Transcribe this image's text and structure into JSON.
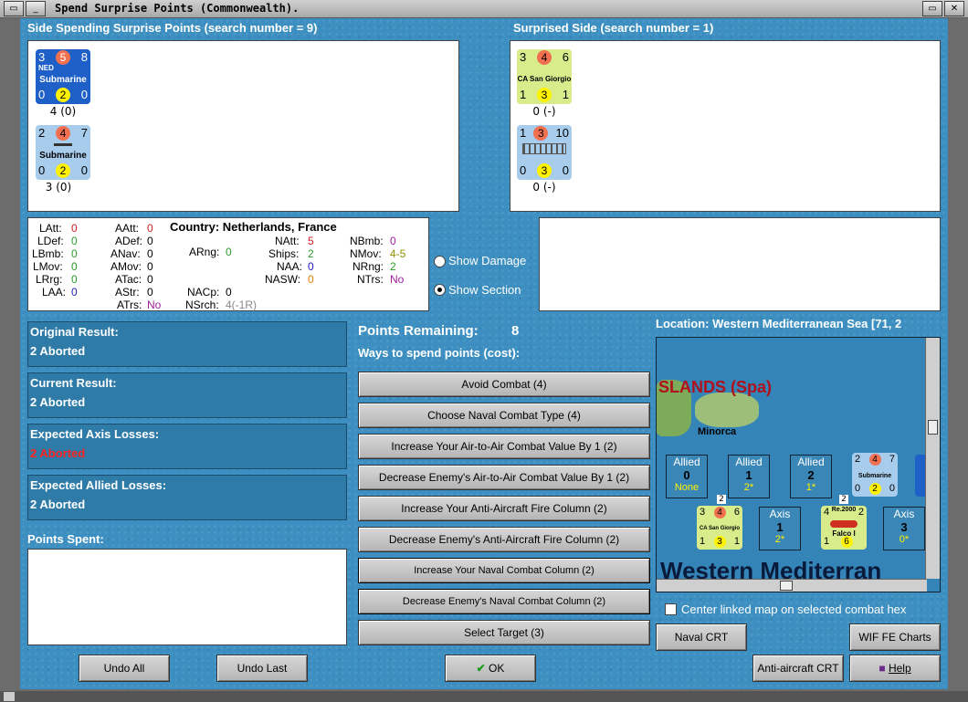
{
  "window": {
    "title": "Spend Surprise Points (Commonwealth)."
  },
  "spending_side": {
    "header": "Side Spending Surprise Points (search number = 9)",
    "units": [
      {
        "top_left": "3",
        "top_mid": "5",
        "top_right": "8",
        "nation": "NED",
        "type": "Submarine",
        "bot_left": "0",
        "bot_mid": "2",
        "bot_right": "0",
        "caption": "4 (0)",
        "color": "#1e5fc8"
      },
      {
        "top_left": "2",
        "top_mid": "4",
        "top_right": "7",
        "nation": "",
        "type": "Submarine",
        "bot_left": "0",
        "bot_mid": "2",
        "bot_right": "0",
        "caption": "3 (0)",
        "color": "#a8ccec"
      }
    ]
  },
  "surprised_side": {
    "header": "Surprised Side (search number = 1)",
    "units": [
      {
        "top_left": "3",
        "top_mid": "4",
        "top_right": "6",
        "type": "CA San Giorgio",
        "bot_left": "1",
        "bot_mid": "3",
        "bot_right": "1",
        "caption": "0 (-)",
        "color": "#d8ec8c"
      },
      {
        "top_left": "1",
        "top_mid": "3",
        "top_right": "10",
        "type": "",
        "bot_left": "0",
        "bot_mid": "3",
        "bot_right": "0",
        "caption": "0 (-)",
        "color": "#a8ccec"
      }
    ]
  },
  "stats": {
    "latt_label": "LAtt:",
    "latt": "0",
    "ldef_label": "LDef:",
    "ldef": "0",
    "lbmb_label": "LBmb:",
    "lbmb": "0",
    "lmov_label": "LMov:",
    "lmov": "0",
    "lrrg_label": "LRrg:",
    "lrrg": "0",
    "laa_label": "LAA:",
    "laa": "0",
    "aatt_label": "AAtt:",
    "aatt": "0",
    "adef_label": "ADef:",
    "adef": "0",
    "anav_label": "ANav:",
    "anav": "0",
    "amov_label": "AMov:",
    "amov": "0",
    "atac_label": "ATac:",
    "atac": "0",
    "astr_label": "AStr:",
    "astr": "0",
    "atrs_label": "ATrs:",
    "atrs": "No",
    "country": "Country: Netherlands, France",
    "arng_label": "ARng:",
    "arng": "0",
    "nacp_label": "NACp:",
    "nacp": "0",
    "nsrch_label": "NSrch:",
    "nsrch": "4(-1R)",
    "natt_label": "NAtt:",
    "natt": "5",
    "ships_label": "Ships:",
    "ships": "2",
    "naa_label": "NAA:",
    "naa": "0",
    "nasw_label": "NASW:",
    "nasw": "0",
    "nbmb_label": "NBmb:",
    "nbmb": "0",
    "nmov_label": "NMov:",
    "nmov": "4-5",
    "nrng_label": "NRng:",
    "nrng": "2",
    "ntrs_label": "NTrs:",
    "ntrs": "No"
  },
  "options": {
    "show_damage": "Show Damage",
    "show_section": "Show Section"
  },
  "results": [
    {
      "title": "Original Result:",
      "value": "2 Aborted",
      "color": "#ffffff"
    },
    {
      "title": "Current Result:",
      "value": "2 Aborted",
      "color": "#ffffff"
    },
    {
      "title": "Expected Axis Losses:",
      "value": "2 Aborted",
      "color": "#ff2020"
    },
    {
      "title": "Expected Allied Losses:",
      "value": "2 Aborted",
      "color": "#ffffff"
    }
  ],
  "points_spent_label": "Points Spent:",
  "points": {
    "remaining_label": "Points Remaining:",
    "remaining_value": "8",
    "ways_label": "Ways to spend points (cost):",
    "options": [
      "Avoid Combat (4)",
      "Choose Naval Combat Type (4)",
      "Increase Your Air-to-Air Combat Value By 1 (2)",
      "Decrease Enemy's Air-to-Air Combat Value By 1 (2)",
      "Increase Your Anti-Aircraft Fire Column (2)",
      "Decrease Enemy's Anti-Aircraft Fire Column (2)",
      "Increase Your Naval Combat Column (2)",
      "Decrease Enemy's Naval Combat Column (2)",
      "Select Target (3)"
    ]
  },
  "map": {
    "location": "Location: Western Mediterranean Sea [71, 2",
    "islands_label": "SLANDS (Spa)",
    "minorca": "Minorca",
    "sea_name": "Western Mediterran",
    "allied": [
      {
        "side": "Allied",
        "num": "0",
        "sub": "None"
      },
      {
        "side": "Allied",
        "num": "1",
        "sub": "2*"
      },
      {
        "side": "Allied",
        "num": "2",
        "sub": "1*"
      }
    ],
    "axis": [
      {
        "side": "Axis",
        "num": "1",
        "sub": "2*"
      },
      {
        "side": "Axis",
        "num": "3",
        "sub": "0*"
      }
    ],
    "map_counter_sub": {
      "tl": "2",
      "tm": "4",
      "tr": "7",
      "name": "Submarine",
      "bl": "0",
      "bm": "2",
      "br": "0"
    },
    "map_counter_ca": {
      "tl": "3",
      "tm": "4",
      "tr": "6",
      "name": "CA San Giorgio",
      "bl": "1",
      "bm": "3",
      "br": "1"
    },
    "map_counter_air": {
      "tl": "4",
      "tr": "2",
      "name": "Re.2000",
      "sub": "Falco I",
      "bl": "1",
      "bm": "6",
      "br": ""
    },
    "stack_badges": [
      "2",
      "2"
    ],
    "center_label": "Center linked map on selected combat hex"
  },
  "buttons": {
    "naval_crt": "Naval CRT",
    "wif_fe_charts": "WIF FE Charts",
    "aa_crt": "Anti-aircraft CRT",
    "help": "Help",
    "ok": "OK",
    "undo_all": "Undo All",
    "undo_last": "Undo Last"
  },
  "colors": {
    "accent": "#3c8fc0",
    "panel": "#2f7ba8",
    "red_text": "#ff2020",
    "green_text": "#2a9a2a"
  }
}
